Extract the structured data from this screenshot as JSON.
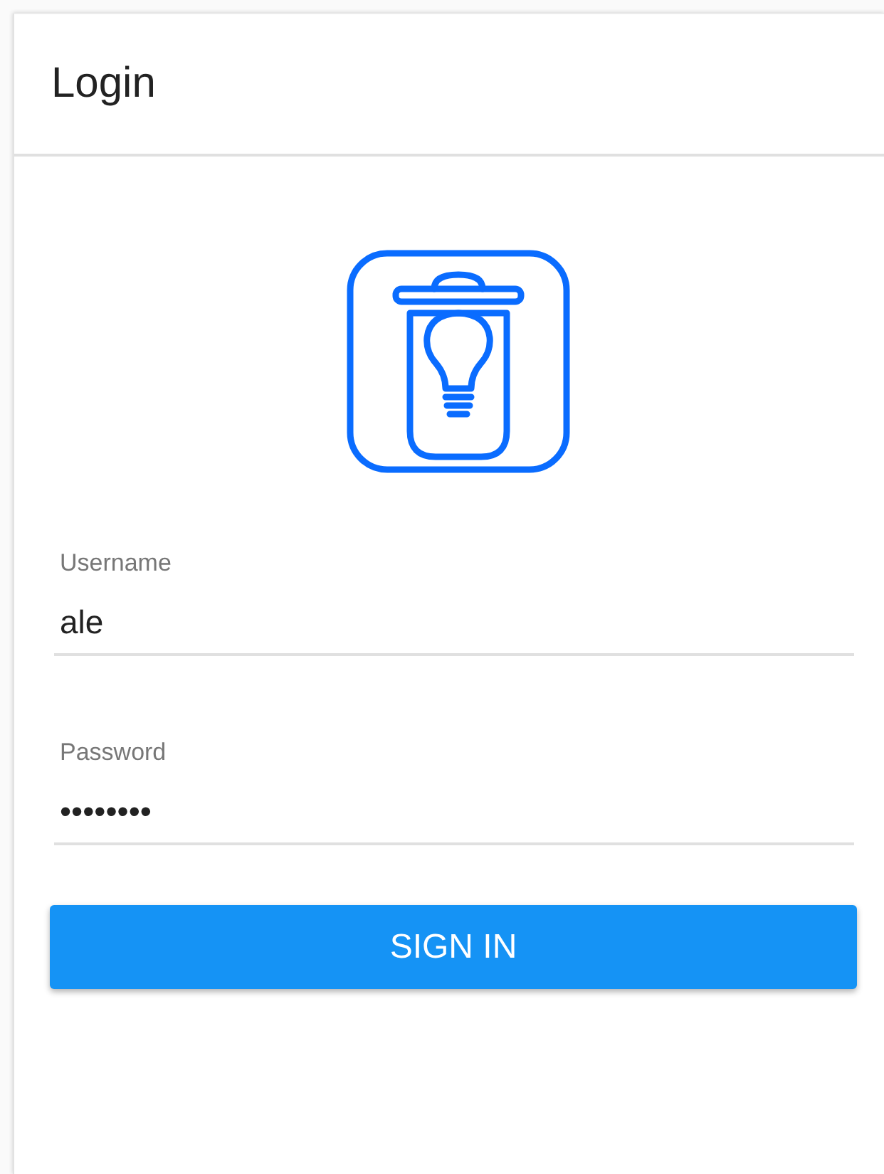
{
  "header": {
    "title": "Login"
  },
  "fields": [
    {
      "label": "Username",
      "value": "ale"
    },
    {
      "label": "Password",
      "value": "••••••••"
    }
  ],
  "button": {
    "label": "SIGN IN"
  }
}
